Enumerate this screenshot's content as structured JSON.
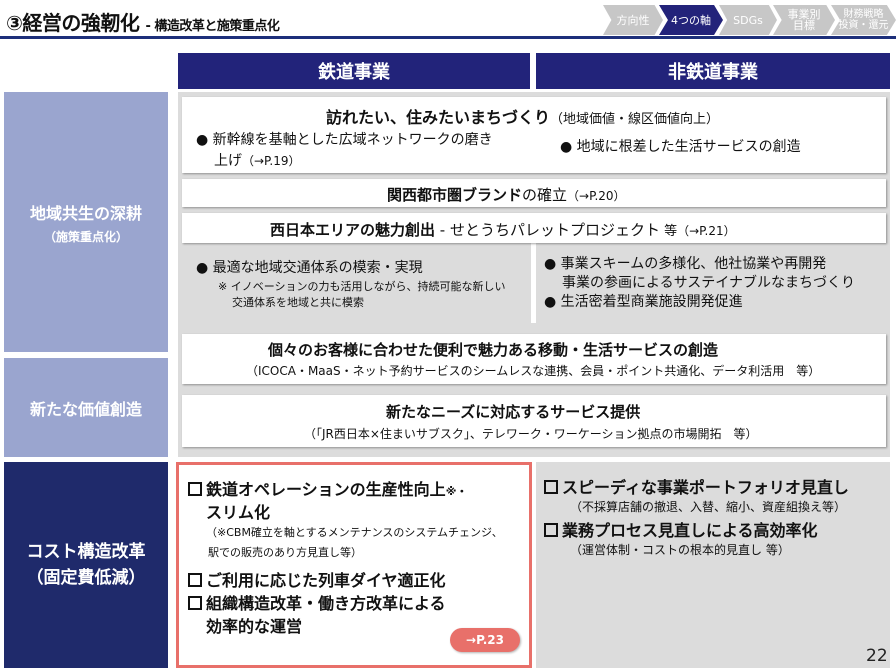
{
  "header": {
    "title": "③経営の強靭化",
    "subtitle": "- 構造改革と施策重点化",
    "nav": [
      {
        "label": "方向性",
        "active": false
      },
      {
        "label": "4つの軸",
        "active": true
      },
      {
        "label": "SDGs",
        "active": false
      },
      {
        "label1": "事業別",
        "label2": "目標",
        "active": false
      },
      {
        "label1": "財務戦略",
        "label2": "投資・還元",
        "active": false
      }
    ]
  },
  "columns": {
    "rail": "鉄道事業",
    "nonrail": "非鉄道事業"
  },
  "rows": {
    "regional": {
      "label": "地域共生の深耕",
      "sub": "（施策重点化）"
    },
    "value": {
      "label": "新たな価値創造"
    },
    "cost": {
      "label1": "コスト構造改革",
      "label2": "（固定費低減）"
    }
  },
  "regional": {
    "town": {
      "title": "訪れたい、住みたいまちづくり",
      "title_note": "（地域価値・線区価値向上）",
      "rail_bullet_1": "● 新幹線を基軸とした広域ネットワークの磨き",
      "rail_bullet_2": "上げ",
      "rail_ref": "（→P.19）",
      "nonrail_bullet": "● 地域に根差した生活サービスの創造"
    },
    "kansai": {
      "bold": "関西都市圏ブランド",
      "rest": "の確立",
      "ref": "（→P.20）"
    },
    "west": {
      "bold": "西日本エリアの魅力創出",
      "rest": " - せとうちパレットプロジェクト",
      "etc": " 等",
      "ref": "（→P.21）"
    },
    "rail_detail": {
      "bullet": "● 最適な地域交通体系の模索・実現",
      "note1": "※ イノベーションの力も活用しながら、持続可能な新しい",
      "note2": "交通体系を地域と共に模索"
    },
    "nonrail_detail": {
      "bullet1_a": "● 事業スキームの多様化、他社協業や再開発",
      "bullet1_b": "事業の参画によるサステイナブルなまちづくり",
      "bullet2": "● 生活密着型商業施設開発促進"
    }
  },
  "value": {
    "mobility": {
      "title": "個々のお客様に合わせた便利で魅力ある移動・生活サービスの創造",
      "note": "（ICOCA・MaaS・ネット予約サービスのシームレスな連携、会員・ポイント共通化、データ利活用　等）"
    },
    "needs": {
      "title": "新たなニーズに対応するサービス提供",
      "note": "（「JR西日本×住まいサブスク」、テレワーク・ワーケーション拠点の市場開拓　等）"
    }
  },
  "cost": {
    "rail": {
      "item1_a": "鉄道オペレーションの生産性向上",
      "item1_mark": "※・",
      "item1_b": "スリム化",
      "note1": "（※CBM確立を軸とするメンテナンスのシステムチェンジ、",
      "note2": "駅での販売のあり方見直し等）",
      "item2": "ご利用に応じた列車ダイヤ適正化",
      "item3_a": "組織構造改革・働き方改革による",
      "item3_b": "効率的な運営",
      "ref": "→P.23"
    },
    "nonrail": {
      "item1": "スピーディな事業ポートフォリオ見直し",
      "note1": "（不採算店舗の撤退、入替、縮小、資産組換え等）",
      "item2": "業務プロセス見直しによる高効率化",
      "note2": "（運営体制・コストの根本的見直し 等）"
    }
  },
  "page_number": "22",
  "colors": {
    "navy": "#22237a",
    "row_label": "#9aa5cf",
    "highlight": "#e8706a",
    "gray": "#dcdcdc"
  }
}
